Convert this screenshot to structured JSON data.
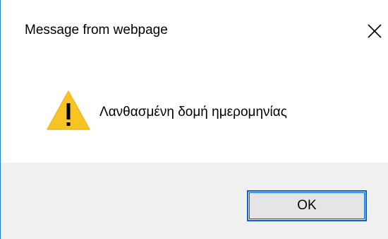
{
  "dialog": {
    "title": "Message from webpage",
    "message": "Λανθασμένη δομή ημερομηνίας",
    "ok_label": "OK",
    "icons": {
      "close": "close-icon",
      "warning": "warning-icon"
    },
    "colors": {
      "window_border": "#2b79d6",
      "warning_fill": "#f7c325",
      "footer_background": "#f0f0f0",
      "button_border": "#0a64d0",
      "button_background": "#e5e5e5"
    }
  }
}
